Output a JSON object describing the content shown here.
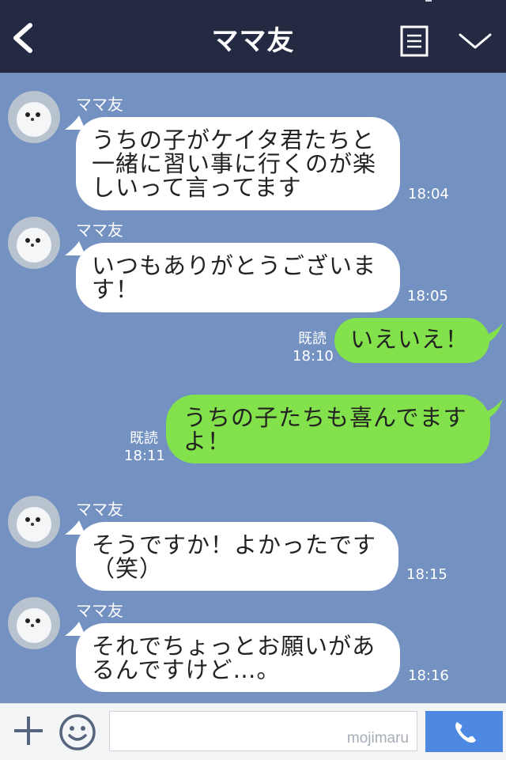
{
  "header": {
    "title": "ママ友",
    "back_icon": "chevron-left-icon",
    "menu_icon": "notes-icon",
    "down_icon": "chevron-down-icon"
  },
  "messages": [
    {
      "sender": "ママ友",
      "text_lines": [
        "うちの子がケイタ君たちと",
        "一緒に習い事に行くのが楽",
        "しいって言ってます"
      ],
      "time": "18:04"
    },
    {
      "sender": "ママ友",
      "text_lines": [
        "いつもありがとうございま",
        "す！"
      ],
      "time": "18:05"
    },
    {
      "read": "既読",
      "time": "18:10",
      "text_lines": [
        "いえいえ！"
      ]
    },
    {
      "read": "既読",
      "time": "18:11",
      "text_lines": [
        "うちの子たちも喜んでます",
        "よ！"
      ]
    },
    {
      "sender": "ママ友",
      "text_lines": [
        "そうですか！よかったです",
        "（笑）"
      ],
      "time": "18:15"
    },
    {
      "sender": "ママ友",
      "text_lines": [
        "それでちょっとお願いがあ",
        "るんですけど…。"
      ],
      "time": "18:16"
    }
  ],
  "footer": {
    "watermark": "mojimaru",
    "plus_icon": "plus-icon",
    "smile_icon": "smile-icon",
    "call_icon": "phone-icon"
  },
  "colors": {
    "header_bg": "#232a42",
    "chat_bg": "#7392c2",
    "outgoing_bubble": "#83e14b",
    "incoming_bubble": "#ffffff",
    "call_button": "#4d88e3"
  }
}
